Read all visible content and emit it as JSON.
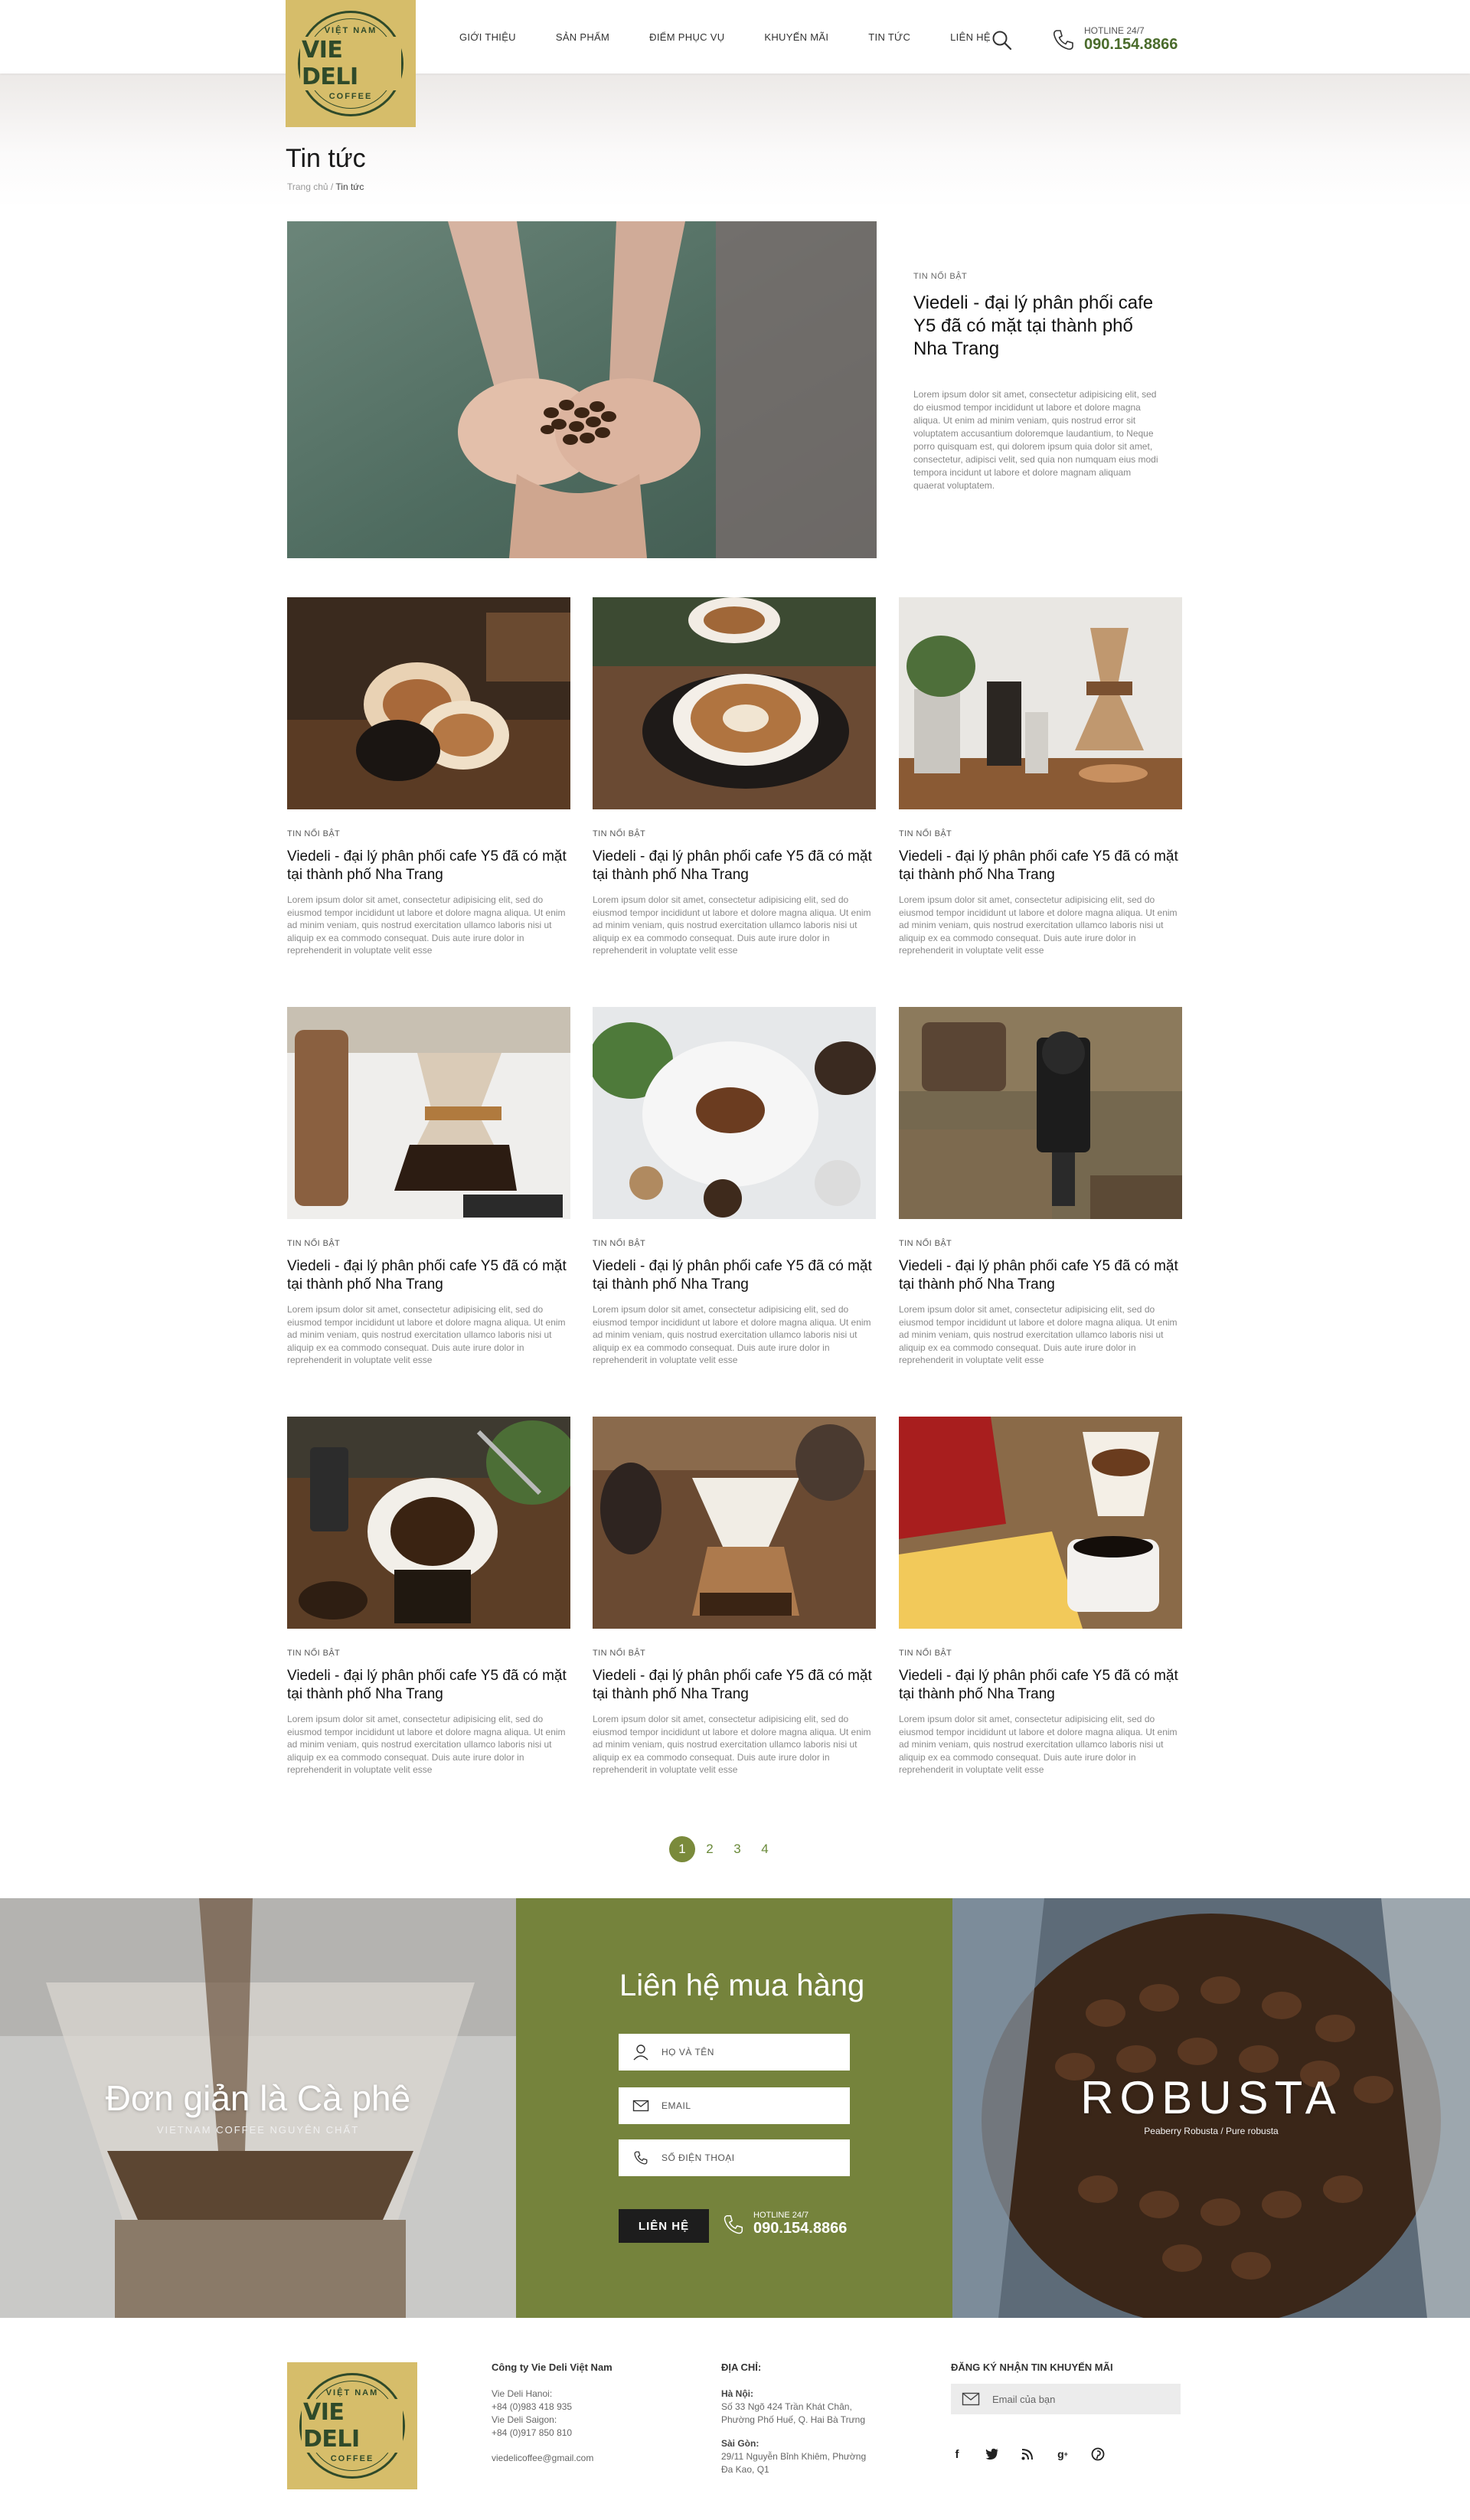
{
  "header": {
    "logo": {
      "top": "VIỆT NAM",
      "main": "VIE DELI",
      "bottom": "COFFEE"
    },
    "nav": [
      "GIỚI THIỆU",
      "SẢN PHẨM",
      "ĐIỂM PHỤC VỤ",
      "KHUYẾN MÃI",
      "TIN TỨC",
      "LIÊN HỆ"
    ],
    "hotline_label": "HOTLINE 24/7",
    "hotline_number": "090.154.8866"
  },
  "page": {
    "title": "Tin tức",
    "breadcrumb_home": "Trang chủ",
    "breadcrumb_sep": " / ",
    "breadcrumb_current": "Tin tức"
  },
  "featured": {
    "tag": "TIN NỔI BẬT",
    "title": "Viedeli - đại lý phân phối cafe Y5 đã có mặt tại thành phố Nha Trang",
    "excerpt": "Lorem ipsum dolor sit amet, consectetur adipisicing elit, sed do eiusmod tempor incididunt ut labore et dolore magna aliqua. Ut enim ad minim veniam, quis nostrud error sit voluptatem accusantium doloremque laudantium, to Neque porro quisquam est, qui dolorem ipsum quia dolor sit amet, consectetur, adipisci velit, sed quia non numquam eius modi tempora incidunt ut labore et dolore magnam aliquam quaerat voluptatem."
  },
  "articles": [
    {
      "tag": "TIN NỔI BẬT",
      "title": "Viedeli - đại lý phân phối cafe Y5 đã có mặt tại thành phố Nha Trang",
      "excerpt": "Lorem ipsum dolor sit amet, consectetur adipisicing elit, sed do eiusmod tempor incididunt ut labore et dolore magna aliqua. Ut enim ad minim veniam, quis nostrud exercitation ullamco laboris nisi ut aliquip ex ea commodo consequat. Duis aute irure dolor in reprehenderit in voluptate velit esse"
    },
    {
      "tag": "TIN NỔI BẬT",
      "title": "Viedeli - đại lý phân phối cafe Y5 đã có mặt tại thành phố Nha Trang",
      "excerpt": "Lorem ipsum dolor sit amet, consectetur adipisicing elit, sed do eiusmod tempor incididunt ut labore et dolore magna aliqua. Ut enim ad minim veniam, quis nostrud exercitation ullamco laboris nisi ut aliquip ex ea commodo consequat. Duis aute irure dolor in reprehenderit in voluptate velit esse"
    },
    {
      "tag": "TIN NỔI BẬT",
      "title": "Viedeli - đại lý phân phối cafe Y5 đã có mặt tại thành phố Nha Trang",
      "excerpt": "Lorem ipsum dolor sit amet, consectetur adipisicing elit, sed do eiusmod tempor incididunt ut labore et dolore magna aliqua. Ut enim ad minim veniam, quis nostrud exercitation ullamco laboris nisi ut aliquip ex ea commodo consequat. Duis aute irure dolor in reprehenderit in voluptate velit esse"
    },
    {
      "tag": "TIN NỔI BẬT",
      "title": "Viedeli - đại lý phân phối cafe Y5 đã có mặt tại thành phố Nha Trang",
      "excerpt": "Lorem ipsum dolor sit amet, consectetur adipisicing elit, sed do eiusmod tempor incididunt ut labore et dolore magna aliqua. Ut enim ad minim veniam, quis nostrud exercitation ullamco laboris nisi ut aliquip ex ea commodo consequat. Duis aute irure dolor in reprehenderit in voluptate velit esse"
    },
    {
      "tag": "TIN NỔI BẬT",
      "title": "Viedeli - đại lý phân phối cafe Y5 đã có mặt tại thành phố Nha Trang",
      "excerpt": "Lorem ipsum dolor sit amet, consectetur adipisicing elit, sed do eiusmod tempor incididunt ut labore et dolore magna aliqua. Ut enim ad minim veniam, quis nostrud exercitation ullamco laboris nisi ut aliquip ex ea commodo consequat. Duis aute irure dolor in reprehenderit in voluptate velit esse"
    },
    {
      "tag": "TIN NỔI BẬT",
      "title": "Viedeli - đại lý phân phối cafe Y5 đã có mặt tại thành phố Nha Trang",
      "excerpt": "Lorem ipsum dolor sit amet, consectetur adipisicing elit, sed do eiusmod tempor incididunt ut labore et dolore magna aliqua. Ut enim ad minim veniam, quis nostrud exercitation ullamco laboris nisi ut aliquip ex ea commodo consequat. Duis aute irure dolor in reprehenderit in voluptate velit esse"
    },
    {
      "tag": "TIN NỔI BẬT",
      "title": "Viedeli - đại lý phân phối cafe Y5 đã có mặt tại thành phố Nha Trang",
      "excerpt": "Lorem ipsum dolor sit amet, consectetur adipisicing elit, sed do eiusmod tempor incididunt ut labore et dolore magna aliqua. Ut enim ad minim veniam, quis nostrud exercitation ullamco laboris nisi ut aliquip ex ea commodo consequat. Duis aute irure dolor in reprehenderit in voluptate velit esse"
    },
    {
      "tag": "TIN NỔI BẬT",
      "title": "Viedeli - đại lý phân phối cafe Y5 đã có mặt tại thành phố Nha Trang",
      "excerpt": "Lorem ipsum dolor sit amet, consectetur adipisicing elit, sed do eiusmod tempor incididunt ut labore et dolore magna aliqua. Ut enim ad minim veniam, quis nostrud exercitation ullamco laboris nisi ut aliquip ex ea commodo consequat. Duis aute irure dolor in reprehenderit in voluptate velit esse"
    },
    {
      "tag": "TIN NỔI BẬT",
      "title": "Viedeli - đại lý phân phối cafe Y5 đã có mặt tại thành phố Nha Trang",
      "excerpt": "Lorem ipsum dolor sit amet, consectetur adipisicing elit, sed do eiusmod tempor incididunt ut labore et dolore magna aliqua. Ut enim ad minim veniam, quis nostrud exercitation ullamco laboris nisi ut aliquip ex ea commodo consequat. Duis aute irure dolor in reprehenderit in voluptate velit esse"
    }
  ],
  "pagination": {
    "pages": [
      "1",
      "2",
      "3",
      "4"
    ],
    "active": "1"
  },
  "contact_band": {
    "slogan": "Đơn giản là Cà phê",
    "slogan_sub": "VIETNAM COFFEE NGUYÊN CHẤT",
    "form_title": "Liên hệ mua hàng",
    "name_placeholder": "HỌ VÀ TÊN",
    "email_placeholder": "EMAIL",
    "phone_placeholder": "SỐ ĐIỆN THOẠI",
    "submit": "LIÊN HỆ",
    "hotline_label": "HOTLINE 24/7",
    "hotline_number": "090.154.8866",
    "robusta": "ROBUSTA",
    "robusta_sub": "Peaberry Robusta / Pure robusta"
  },
  "footer": {
    "company": "Công ty Vie Deli Việt Nam",
    "hanoi_label": "Vie Deli Hanoi:",
    "hanoi_phone": "+84 (0)983 418 935",
    "saigon_label": "Vie Deli Saigon:",
    "saigon_phone": "+84 (0)917 850 810",
    "email": "viedelicoffee@gmail.com",
    "address_head": "ĐỊA CHỈ:",
    "hanoi_addr_label": "Hà Nội:",
    "hanoi_addr_1": "Số 33 Ngõ 424 Trần Khát Chân,",
    "hanoi_addr_2": "Phường Phố Huế, Q. Hai Bà Trưng",
    "saigon_addr_label": "Sài Gòn:",
    "saigon_addr_1": "29/11 Nguyễn Bỉnh Khiêm, Phường",
    "saigon_addr_2": "Đa Kao, Q1",
    "newsletter_head": "ĐĂNG KÝ NHẬN TIN KHUYẾN MÃI",
    "newsletter_placeholder": "Email của bạn",
    "socials": [
      "facebook-icon",
      "twitter-icon",
      "rss-icon",
      "google-plus-icon",
      "pinterest-icon"
    ]
  },
  "colors": {
    "logo_bg": "#d6bd6a",
    "brand_green": "#75833c",
    "logo_ink": "#2f4a2a",
    "accent": "#4a6b2b"
  }
}
